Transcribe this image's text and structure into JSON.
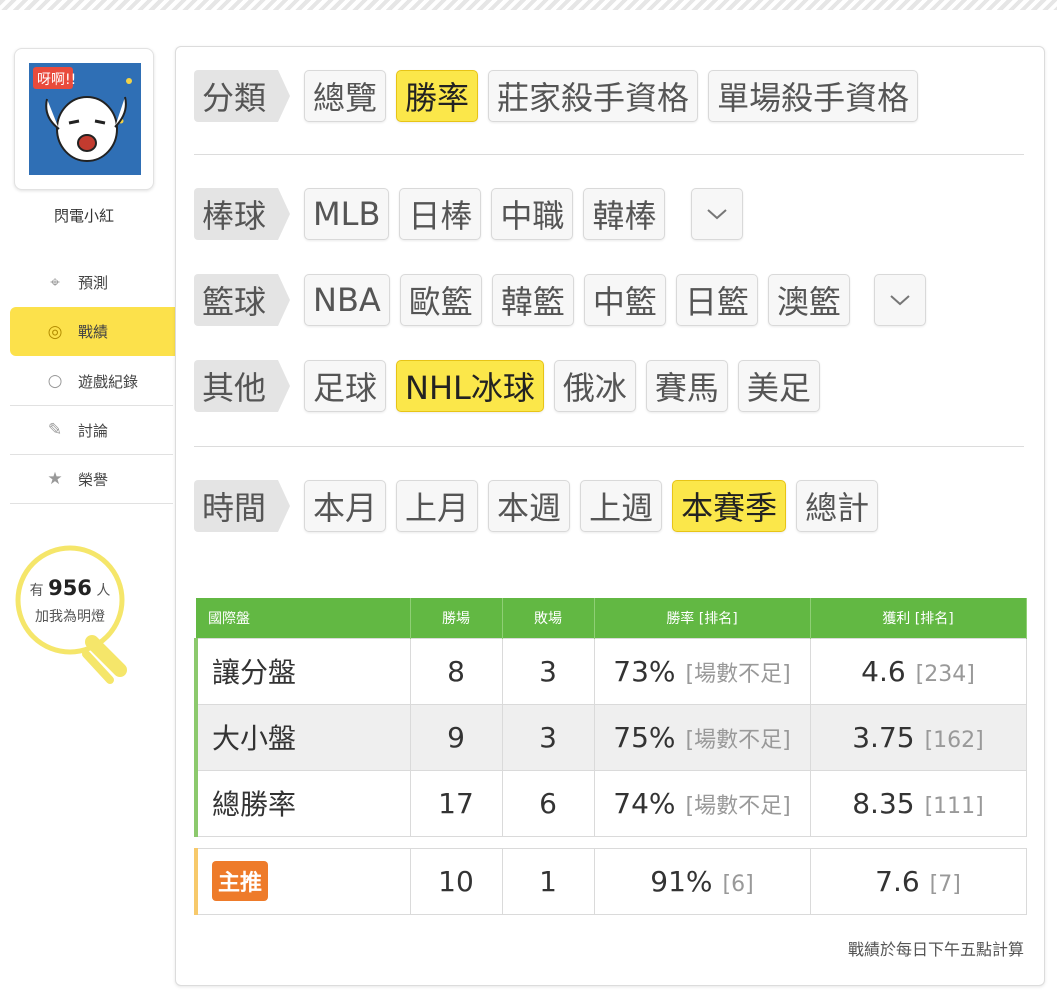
{
  "user": {
    "name": "閃電小紅",
    "avatar_text": "呀啊!!"
  },
  "nav": [
    {
      "label": "預測",
      "icon": "crosshair-icon"
    },
    {
      "label": "戰績",
      "icon": "target-icon"
    },
    {
      "label": "遊戲紀錄",
      "icon": "circle-icon"
    },
    {
      "label": "討論",
      "icon": "chat-icon"
    },
    {
      "label": "榮譽",
      "icon": "medal-icon"
    }
  ],
  "followers": {
    "prefix": "有",
    "count": "956",
    "suffix": "人",
    "line2": "加我為明燈"
  },
  "filters": {
    "category": {
      "label": "分類",
      "options": [
        "總覽",
        "勝率",
        "莊家殺手資格",
        "單場殺手資格"
      ],
      "active": "勝率"
    },
    "baseball": {
      "label": "棒球",
      "options": [
        "MLB",
        "日棒",
        "中職",
        "韓棒"
      ]
    },
    "basketball": {
      "label": "籃球",
      "options": [
        "NBA",
        "歐籃",
        "韓籃",
        "中籃",
        "日籃",
        "澳籃"
      ]
    },
    "other": {
      "label": "其他",
      "options": [
        "足球",
        "NHL冰球",
        "俄冰",
        "賽馬",
        "美足"
      ],
      "active": "NHL冰球"
    },
    "time": {
      "label": "時間",
      "options": [
        "本月",
        "上月",
        "本週",
        "上週",
        "本賽季",
        "總計"
      ],
      "active": "本賽季"
    }
  },
  "table": {
    "headers": [
      "國際盤",
      "勝場",
      "敗場",
      "勝率 [排名]",
      "獲利 [排名]"
    ],
    "rows": [
      {
        "name": "讓分盤",
        "win": "8",
        "loss": "3",
        "rate": "73%",
        "rate_rank": "[場數不足]",
        "profit": "4.6",
        "profit_rank": "[234]"
      },
      {
        "name": "大小盤",
        "win": "9",
        "loss": "3",
        "rate": "75%",
        "rate_rank": "[場數不足]",
        "profit": "3.75",
        "profit_rank": "[162]"
      },
      {
        "name": "總勝率",
        "win": "17",
        "loss": "6",
        "rate": "74%",
        "rate_rank": "[場數不足]",
        "profit": "8.35",
        "profit_rank": "[111]"
      }
    ],
    "main": {
      "badge": "主推",
      "win": "10",
      "loss": "1",
      "rate": "91%",
      "rate_rank": "[6]",
      "profit": "7.6",
      "profit_rank": "[7]"
    }
  },
  "footnote": "戰績於每日下午五點計算",
  "colors": {
    "accent_yellow": "#fbe74a",
    "header_green": "#62b843",
    "badge_orange": "#ee7b2a"
  }
}
